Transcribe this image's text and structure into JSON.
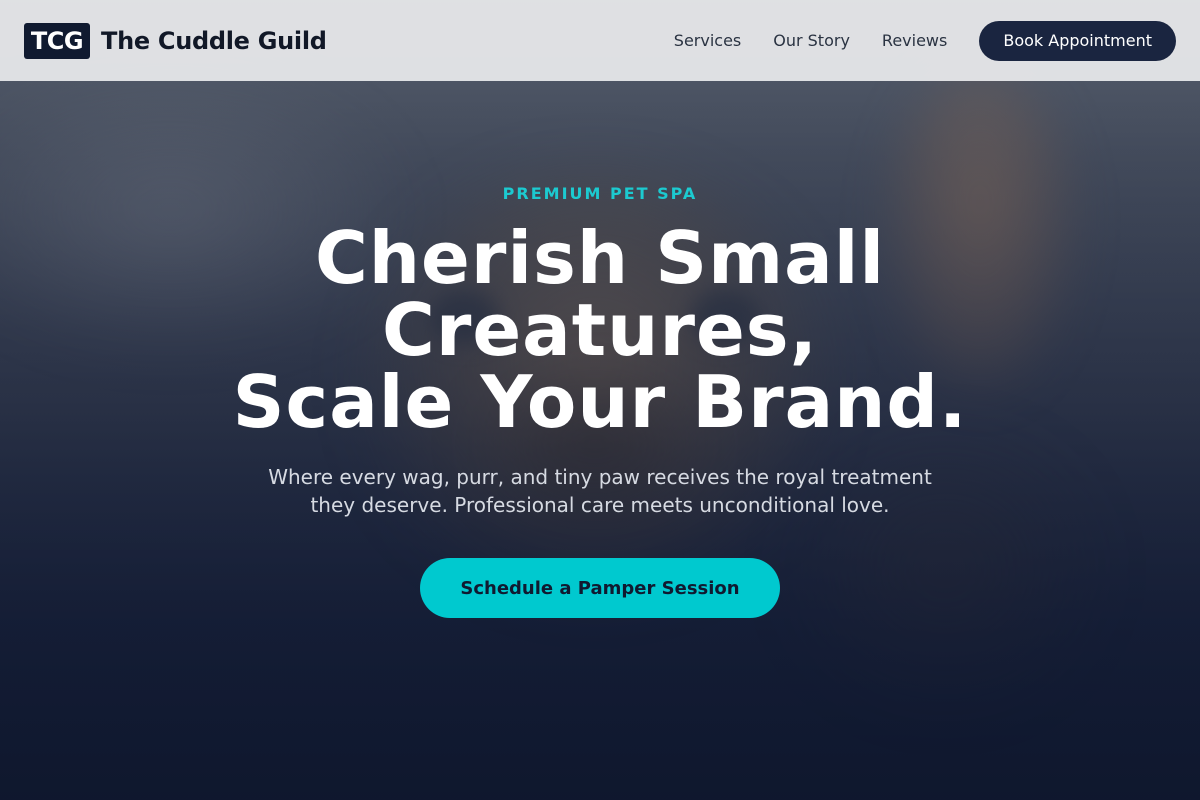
{
  "header": {
    "logo_badge": "TCG",
    "brand_name": "The Cuddle Guild",
    "nav": [
      {
        "label": "Services"
      },
      {
        "label": "Our Story"
      },
      {
        "label": "Reviews"
      }
    ],
    "book_label": "Book Appointment"
  },
  "hero": {
    "eyebrow": "PREMIUM PET SPA",
    "headline_lines": [
      "Cherish Small",
      "Creatures,",
      "Scale Your Brand."
    ],
    "subtext": "Where every wag, purr, and tiny paw receives the royal treatment they deserve. Professional care meets unconditional love.",
    "cta_label": "Schedule a Pamper Session"
  },
  "colors": {
    "accent": "#00c9cf",
    "navy": "#1a2540",
    "header_bg": "#e8e9eb"
  }
}
